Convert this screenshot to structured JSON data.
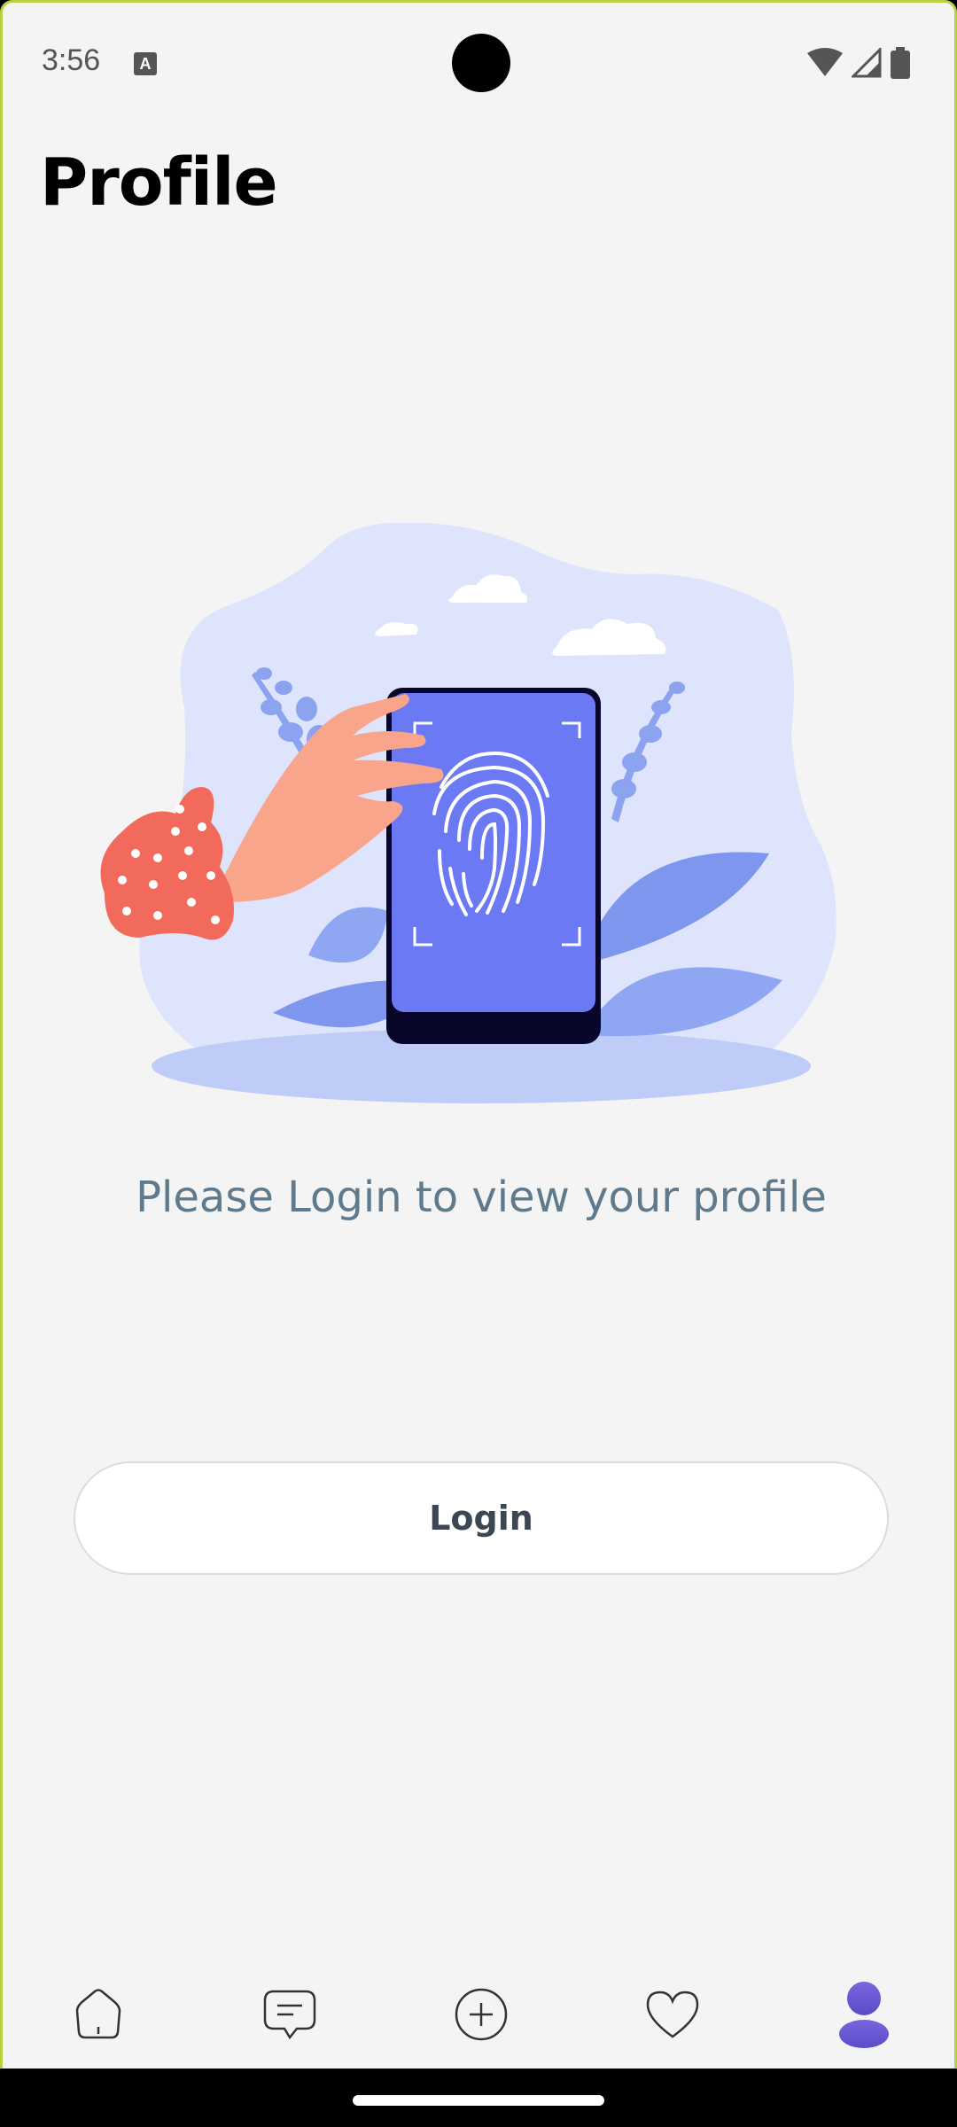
{
  "status_bar": {
    "time": "3:56",
    "app_icon_letter": "A"
  },
  "header": {
    "title": "Profile"
  },
  "main": {
    "illustration": "fingerprint-phone-login-illustration",
    "message": "Please Login to view your profile",
    "login_button_label": "Login"
  },
  "bottom_nav": {
    "items": [
      {
        "icon": "home-icon",
        "active": false
      },
      {
        "icon": "chat-icon",
        "active": false
      },
      {
        "icon": "add-icon",
        "active": false
      },
      {
        "icon": "heart-icon",
        "active": false
      },
      {
        "icon": "profile-icon",
        "active": true
      }
    ],
    "active_color": "#6b5bd6"
  },
  "colors": {
    "background": "#f4f4f4",
    "accent": "#6b79f5",
    "message_text": "#5f7a8c"
  }
}
